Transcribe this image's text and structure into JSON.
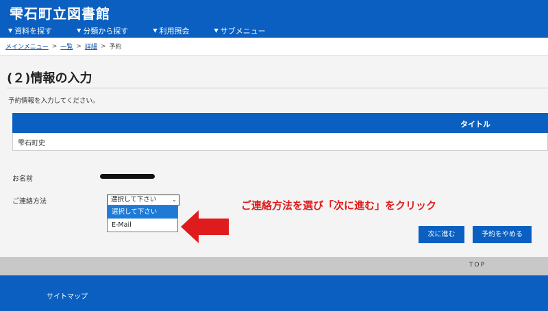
{
  "header": {
    "site_title": "雫石町立図書館",
    "nav": [
      {
        "label": "資料を探す"
      },
      {
        "label": "分類から探す"
      },
      {
        "label": "利用照会"
      },
      {
        "label": "サブメニュー"
      }
    ]
  },
  "breadcrumb": {
    "items": [
      "メインメニュー",
      "一覧",
      "詳細"
    ],
    "separator": ">",
    "current": "予約"
  },
  "page": {
    "title": "(２)情報の入力",
    "instruction": "予約情報を入力してください。"
  },
  "table": {
    "header": "タイトル",
    "rows": [
      "雫石町史"
    ]
  },
  "form": {
    "name_label": "お名前",
    "contact_label": "ご連絡方法",
    "contact_selected": "選択して下さい",
    "contact_options": [
      "選択して下さい",
      "E-Mail"
    ]
  },
  "annotation": "ご連絡方法を選び「次に進む」をクリック",
  "buttons": {
    "next": "次に進む",
    "cancel": "予約をやめる"
  },
  "footer": {
    "top_link": "TOP",
    "sitemap": "サイトマップ"
  },
  "colors": {
    "brand_blue": "#0a5fc0",
    "annotation_red": "#e01b1b"
  }
}
